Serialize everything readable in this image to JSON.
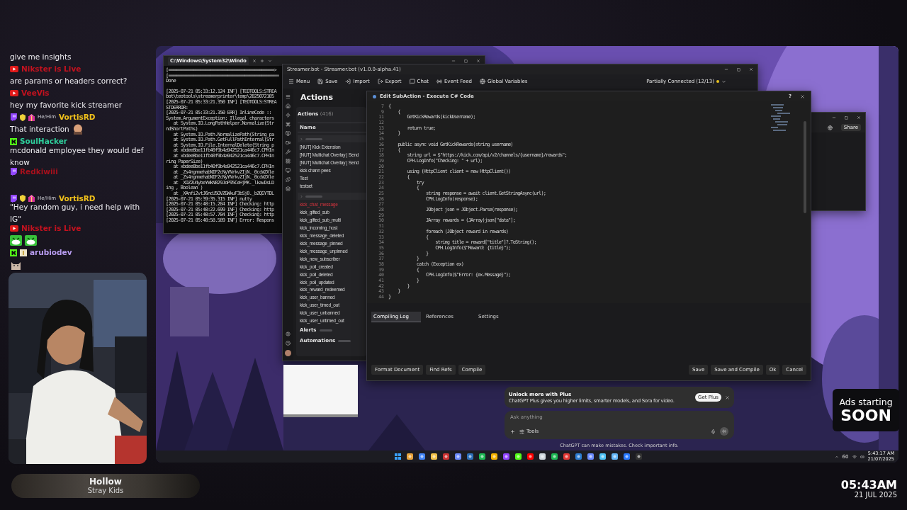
{
  "chat": [
    {
      "kind": "text",
      "text": "give me insights"
    },
    {
      "kind": "youtube-user",
      "name": "Nikster is Live",
      "color": "#c4121f"
    },
    {
      "kind": "text",
      "text": "are params or headers correct?"
    },
    {
      "kind": "youtube-user",
      "name": "VeeVis",
      "color": "#c4121f"
    },
    {
      "kind": "text",
      "text": "hey my favorite kick streamer"
    },
    {
      "kind": "twitch-user-badged",
      "pronoun": "He/Him",
      "name": "VortisRD",
      "color": "#f2c21b"
    },
    {
      "kind": "text-emote",
      "text": "That interaction"
    },
    {
      "kind": "kick-user",
      "name": "SoulHacker",
      "color": "#2fcf9c"
    },
    {
      "kind": "text",
      "text": "mcdonald employee they would def know"
    },
    {
      "kind": "twitch-user",
      "name": "Redkiwiii",
      "color": "#a8101c"
    },
    {
      "kind": "gap"
    },
    {
      "kind": "twitch-user-badged",
      "pronoun": "He/Him",
      "name": "VortisRD",
      "color": "#f2c21b"
    },
    {
      "kind": "text",
      "text": "\"Hey random guy, i need help with IG\""
    },
    {
      "kind": "youtube-user",
      "name": "Nikster is Live",
      "color": "#c4121f"
    },
    {
      "kind": "laugh-emotes"
    },
    {
      "kind": "kick-user-tier",
      "name": "arubiodev",
      "color": "#b89cf0"
    },
    {
      "kind": "cat-emote"
    }
  ],
  "now_playing": {
    "title": "Hollow",
    "artist": "Stray Kids"
  },
  "terminal": {
    "tab": "C:\\Windows\\System32\\Windo",
    "blocks": [
      [
        "[===========================================>",
        "[=============================================",
        "Done"
      ],
      [
        "[2025-07-21 05:33:12.124 INF] [TEOTOOLS:STREA",
        "bot\\teotools\\streamerprinter\\temp\\2025072105",
        "[2025-07-21 05:33:21.350 INF] [TEOTOOLS:STREA",
        "STDERROR:",
        "[2025-07-21 05:33:21.350 ERR] InlineCode :: ",
        "System.ArgumentException: Illegal characters",
        "   at System.IO.LongPathHelper.Normalize(Str",
        "ndShortPaths)",
        "   at System.IO.Path.NormalizePath(String pa",
        "   at System.IO.Path.GetFullPathInternal(Str",
        "   at System.IO.File.InternalDelete(String p",
        "   at xbdee8be11fb40f9b4a942521ca446c7.CPHIn",
        "   at xbdee8be11fb40f9b4a942521ca446c7.CPHIn",
        "ring PaperSize)",
        "   at xbdee8be11fb40f9b4a942521ca446c7.CPHIn",
        "   at _Zs4ngnmehabNIF2cNyYNrkvZIjN._0ccWZXle",
        "   at _Zs4ngnmehabNIF2cNyYNrkvZIjN._0ccWZXle",
        "   at _XOZ2U4ybeYWkN829JoP95CeHjMK._lkavDsLD",
        "ing , Boolean )",
        "   at _XAnfi2vtJ6ncU5OVZGWkuF3bSj0._bZQGYTDL",
        "[2025-07-21 05:39:35.315 INF] nutty",
        "[2025-07-21 05:40:15.284 INF] Checking: http",
        "[2025-07-21 05:40:22.699 INF] Checking: http",
        "[2025-07-21 05:40:57.704 INF] Checking: http",
        "[2025-07-21 05:40:58.589 INF] Error: Respons"
      ]
    ]
  },
  "streamerbot": {
    "title": "Streamer.bot - Streamer.bot (v1.0.0-alpha.41)",
    "toolbar": [
      "Menu",
      "Save",
      "Import",
      "Export",
      "Chat",
      "Event Feed",
      "Global Variables"
    ],
    "connection": "Partially Connected (12/13)",
    "heading": "Actions",
    "panel_title": "Actions",
    "panel_count": "(416)",
    "column": "Name",
    "groups": [
      {
        "items": [
          {
            "label": "[NUT] Kick Extension",
            "disabled": false
          },
          {
            "label": "[NUT] Multichat Overlay | Send",
            "disabled": false
          },
          {
            "label": "[NUT] Multichat Overlay | Send",
            "disabled": false
          },
          {
            "label": "kick chann pees",
            "disabled": false
          },
          {
            "label": "Test",
            "disabled": false
          },
          {
            "label": "testset",
            "disabled": false
          }
        ]
      },
      {
        "items": [
          {
            "label": "kick_chat_message",
            "disabled": true
          },
          {
            "label": "kick_gifted_sub",
            "disabled": false
          },
          {
            "label": "kick_gifted_sub_multi",
            "disabled": false
          },
          {
            "label": "kick_incoming_host",
            "disabled": false
          },
          {
            "label": "kick_message_deleted",
            "disabled": false
          },
          {
            "label": "kick_message_pinned",
            "disabled": false
          },
          {
            "label": "kick_message_unpinned",
            "disabled": false
          },
          {
            "label": "kick_new_subscriber",
            "disabled": false
          },
          {
            "label": "kick_poll_created",
            "disabled": false
          },
          {
            "label": "kick_poll_deleted",
            "disabled": false
          },
          {
            "label": "kick_poll_updated",
            "disabled": false
          },
          {
            "label": "kick_reward_redeemed",
            "disabled": false
          },
          {
            "label": "kick_user_banned",
            "disabled": false
          },
          {
            "label": "kick_user_timed_out",
            "disabled": false
          },
          {
            "label": "kick_user_unbanned",
            "disabled": false
          },
          {
            "label": "kick_user_untimed_out",
            "disabled": false
          }
        ]
      }
    ],
    "sections": [
      "Alerts",
      "Automations"
    ]
  },
  "editor": {
    "title": "Edit SubAction - Execute C# Code",
    "lines": [
      {
        "number": "7",
        "text": "{"
      },
      {
        "number": "9",
        "text": "    {"
      },
      {
        "number": "11",
        "text": "        GetKickRewards(kickUsername);"
      },
      {
        "number": "12"
      },
      {
        "number": "13",
        "text": "        return true;"
      },
      {
        "number": "14",
        "text": "    }"
      },
      {
        "number": "15"
      },
      {
        "number": "16",
        "text": "    public async void GetKickRewards(string username)"
      },
      {
        "number": "17",
        "text": "    {"
      },
      {
        "number": "18",
        "text": "        string url = $\"https://kick.com/api/v2/channels/{username}/rewards\";"
      },
      {
        "number": "19",
        "text": "        CPH.LogInfo(\"Checking: \" + url);"
      },
      {
        "number": "20"
      },
      {
        "number": "21",
        "text": "        using (HttpClient client = new HttpClient())"
      },
      {
        "number": "22",
        "text": "        {"
      },
      {
        "number": "23",
        "text": "            try"
      },
      {
        "number": "24",
        "text": "            {"
      },
      {
        "number": "25",
        "text": "                string response = await client.GetStringAsync(url);"
      },
      {
        "number": "26",
        "text": "                CPH.LogInfo(response);"
      },
      {
        "number": "27"
      },
      {
        "number": "28",
        "text": "                JObject json = JObject.Parse(response);"
      },
      {
        "number": "29"
      },
      {
        "number": "30",
        "text": "                JArray rewards = (JArray)json[\"data\"];"
      },
      {
        "number": "31"
      },
      {
        "number": "32",
        "text": "                foreach (JObject reward in rewards)"
      },
      {
        "number": "33",
        "text": "                {"
      },
      {
        "number": "34",
        "text": "                    string title = reward[\"title\"]?.ToString();"
      },
      {
        "number": "35",
        "text": "                    CPH.LogInfo($\"Reward: {title}\");"
      },
      {
        "number": "36",
        "text": "                }"
      },
      {
        "number": "37",
        "text": "            }"
      },
      {
        "number": "38",
        "text": "            catch (Exception ex)"
      },
      {
        "number": "39",
        "text": "            {"
      },
      {
        "number": "40",
        "text": "                CPH.LogInfo($\"Error: {ex.Message}\");"
      },
      {
        "number": "41",
        "text": "            }"
      },
      {
        "number": "42",
        "text": "        }"
      },
      {
        "number": "43",
        "text": "    }"
      },
      {
        "number": "44",
        "text": "}"
      }
    ],
    "help": "?",
    "tabs": [
      {
        "label": "Compiling Log",
        "selected": true
      },
      {
        "label": "References",
        "selected": false
      },
      {
        "label": "Settings",
        "selected": false
      }
    ],
    "left_buttons": [
      "Format Document",
      "Find Refs",
      "Compile"
    ],
    "right_buttons": [
      "Save",
      "Save and Compile",
      "Ok",
      "Cancel"
    ]
  },
  "browser": {
    "button": "Share"
  },
  "chatgpt": {
    "banner_title": "Unlock more with Plus",
    "banner_text": "ChatGPT Plus gives you higher limits, smarter models, and Sora for video.",
    "banner_button": "Get Plus",
    "placeholder": "Ask anything",
    "tools": "Tools",
    "disclaimer": "ChatGPT can make mistakes. Check important info."
  },
  "taskbar": {
    "tray_number": "60",
    "time": "5:43:17 AM",
    "date": "21/07/2025"
  },
  "ads": {
    "line1": "Ads starting",
    "line2": "SOON"
  },
  "clock": {
    "time": "05:43AM",
    "date": "21 JUL 2025"
  }
}
